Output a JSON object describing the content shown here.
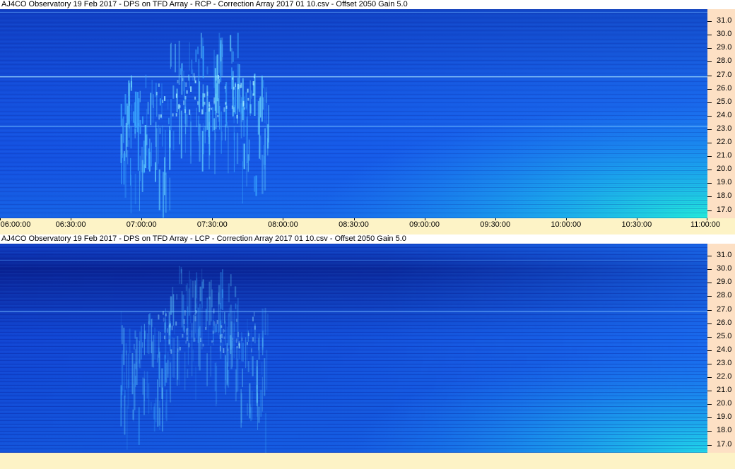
{
  "panels": [
    {
      "title": "AJ4CO Observatory 19 Feb 2017  -  DPS on TFD Array  -  RCP  -  Correction Array 2017 01 10.csv  -  Offset 2050  Gain 5.0",
      "polarization": "RCP"
    },
    {
      "title": "AJ4CO Observatory 19 Feb 2017  -  DPS on TFD Array  -  LCP  -  Correction Array 2017 01 10.csv  -  Offset 2050  Gain 5.0",
      "polarization": "LCP"
    }
  ],
  "chart_data": {
    "type": "heatmap",
    "x_ticks": [
      "06:00:00",
      "06:30:00",
      "07:00:00",
      "07:30:00",
      "08:00:00",
      "08:30:00",
      "09:00:00",
      "09:30:00",
      "10:00:00",
      "10:30:00",
      "11:00:00"
    ],
    "y_ticks": [
      "31.0",
      "30.0",
      "29.0",
      "28.0",
      "27.0",
      "26.0",
      "25.0",
      "24.0",
      "23.0",
      "22.0",
      "21.0",
      "20.0",
      "19.0",
      "18.0",
      "17.0"
    ],
    "xlim": [
      "06:00:00",
      "11:00:00"
    ],
    "ylim": [
      16.4,
      31.9
    ],
    "colormap": [
      "#0a1a8c",
      "#1040d8",
      "#1a6cf0",
      "#1ab0ec",
      "#20e8e0"
    ]
  }
}
